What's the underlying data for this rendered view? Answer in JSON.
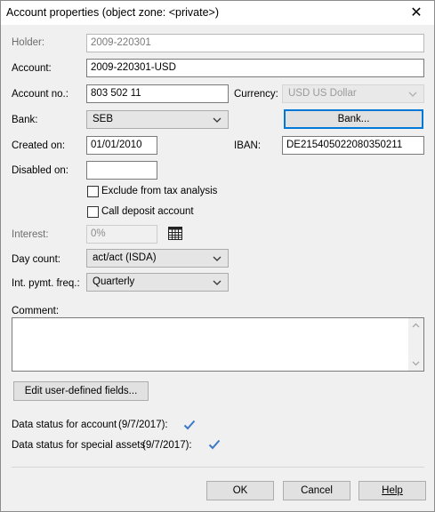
{
  "window": {
    "title": "Account properties (object zone: <private>)",
    "close_label": "✕"
  },
  "labels": {
    "holder": "Holder:",
    "account": "Account:",
    "account_no": "Account no.:",
    "currency": "Currency:",
    "bank": "Bank:",
    "created_on": "Created on:",
    "iban": "IBAN:",
    "disabled_on": "Disabled on:",
    "interest": "Interest:",
    "day_count": "Day count:",
    "int_pymt_freq": "Int. pymt. freq.:",
    "comment": "Comment:"
  },
  "fields": {
    "holder": "2009-220301",
    "account": "2009-220301-USD",
    "account_no": "803 502 11",
    "currency": "USD US Dollar",
    "bank": "SEB",
    "created_on": "01/01/2010",
    "iban": "DE215405022080350211",
    "disabled_on": "",
    "interest": "0%",
    "day_count": "act/act (ISDA)",
    "int_pymt_freq": "Quarterly",
    "comment": ""
  },
  "checkboxes": {
    "exclude_tax": {
      "label": "Exclude from tax analysis",
      "checked": false
    },
    "call_deposit": {
      "label": "Call deposit account",
      "checked": false
    }
  },
  "buttons": {
    "bank": "Bank...",
    "edit_fields": "Edit user-defined fields...",
    "ok": "OK",
    "cancel": "Cancel",
    "help": "Help"
  },
  "status": {
    "account_label": "Data status for account",
    "account_date": "(9/7/2017):",
    "special_label": "Data status for special assets",
    "special_date": "(9/7/2017):"
  },
  "icons": [
    "close-icon",
    "calculator-icon",
    "chevron-down-icon",
    "checkmark-icon"
  ],
  "colors": {
    "check_blue": "#3c78c8",
    "default_button_border": "#0078d7"
  }
}
